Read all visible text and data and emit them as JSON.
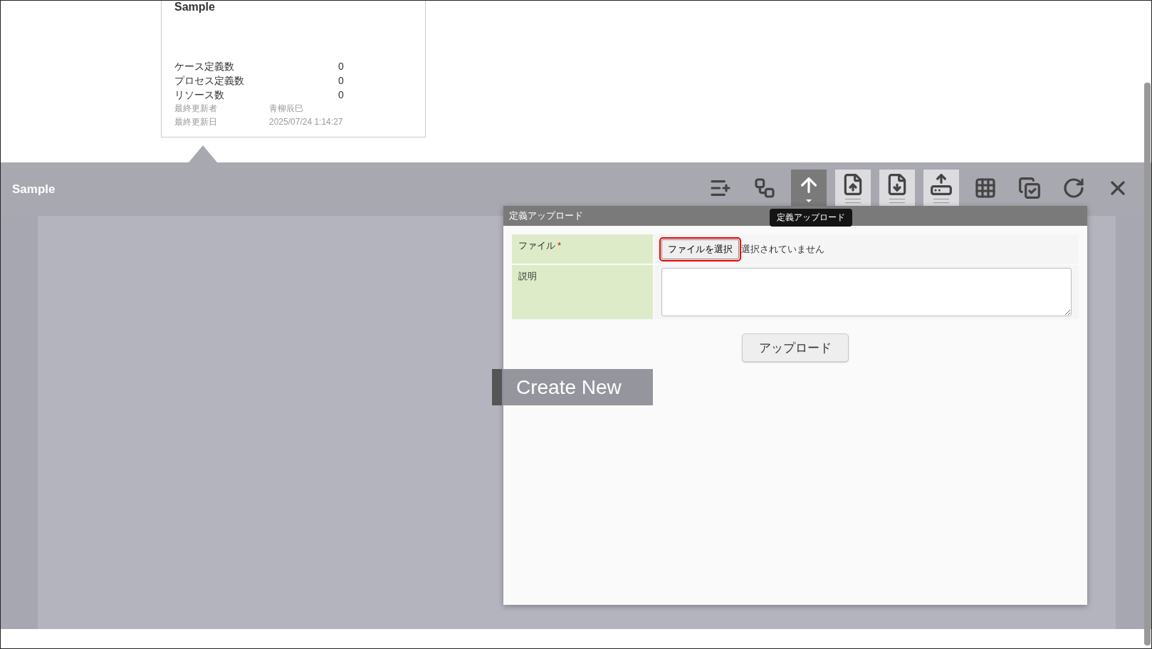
{
  "card": {
    "title": "Sample",
    "stats": [
      {
        "label": "ケース定義数",
        "value": "0"
      },
      {
        "label": "プロセス定義数",
        "value": "0"
      },
      {
        "label": "リソース数",
        "value": "0"
      }
    ],
    "meta": [
      {
        "label": "最終更新者",
        "value": "青柳辰巳"
      },
      {
        "label": "最終更新日",
        "value": "2025/07/24 1:14:27"
      }
    ]
  },
  "header": {
    "title": "Sample",
    "toolbar": [
      {
        "kind": "add-list",
        "selected": false,
        "framed": false
      },
      {
        "kind": "add-flow",
        "selected": false,
        "framed": false
      },
      {
        "kind": "upload-flow",
        "selected": true,
        "framed": false
      },
      {
        "kind": "file-upload",
        "selected": false,
        "framed": true
      },
      {
        "kind": "diagram-download",
        "selected": false,
        "framed": true
      },
      {
        "kind": "drive-upload",
        "selected": false,
        "framed": true
      },
      {
        "kind": "grid",
        "selected": false,
        "framed": false
      },
      {
        "kind": "copy-check",
        "selected": false,
        "framed": false
      },
      {
        "kind": "reload",
        "selected": false,
        "framed": false
      },
      {
        "kind": "close",
        "selected": false,
        "framed": false
      }
    ],
    "tooltip": "定義アップロード"
  },
  "dialog": {
    "title": "定義アップロード",
    "fields": [
      {
        "kind": "file",
        "label": "ファイル",
        "required": true,
        "button": "ファイルを選択",
        "status": "選択されていません",
        "highlighted": true
      },
      {
        "kind": "textarea",
        "label": "説明",
        "required": false
      }
    ],
    "required_mark": "*",
    "submit": "アップロード"
  },
  "create_new": "Create New"
}
